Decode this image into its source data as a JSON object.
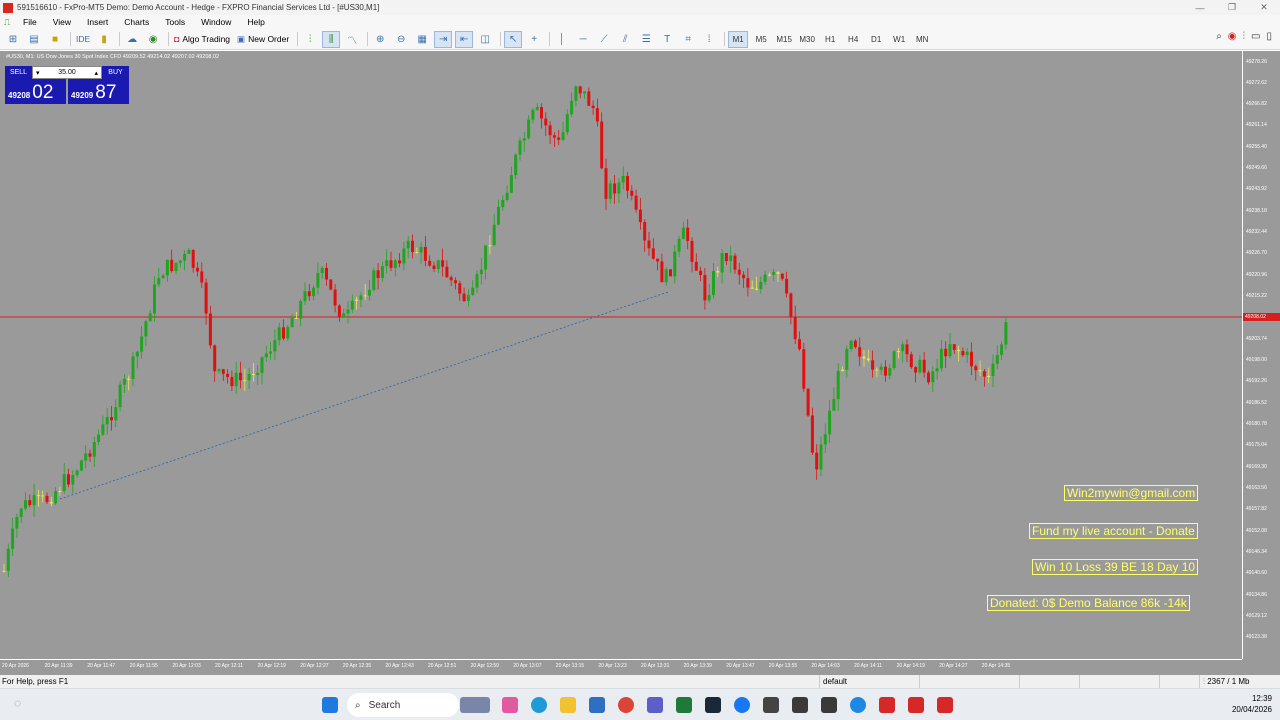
{
  "window": {
    "title": "591516610 - FxPro-MT5 Demo: Demo Account - Hedge - FXPRO Financial Services Ltd - [#US30,M1]",
    "controls": [
      "—",
      "❐",
      "✕"
    ]
  },
  "menu": [
    "File",
    "View",
    "Insert",
    "Charts",
    "Tools",
    "Window",
    "Help"
  ],
  "toolbar": {
    "algo_trading": "Algo Trading",
    "new_order": "New Order",
    "ide": "IDE",
    "timeframes": [
      "M1",
      "M5",
      "M15",
      "M30",
      "H1",
      "H4",
      "D1",
      "W1",
      "MN"
    ],
    "active_timeframe": "M1"
  },
  "chart": {
    "header": "#US30, M1:  US Dow Jones 30 Spot Index CFD   49209.52 49214.02 49207.02 49208.02",
    "trade_panel": {
      "sell_label": "SELL",
      "buy_label": "BUY",
      "lot": "35.00",
      "bid_prefix": "49208",
      "bid_big": "02",
      "ask_prefix": "49209",
      "ask_big": "87"
    },
    "current_price": "49208.02",
    "price_labels": [
      "49278.26",
      "49272.62",
      "49266.82",
      "49261.14",
      "49255.40",
      "49249.66",
      "49243.92",
      "49238.18",
      "49232.44",
      "49226.70",
      "49220.96",
      "49215.22",
      "49203.74",
      "49198.00",
      "49192.26",
      "49186.52",
      "49180.78",
      "49175.04",
      "49169.30",
      "49163.56",
      "49157.82",
      "49152.08",
      "49146.34",
      "49140.60",
      "49134.86",
      "49129.12",
      "49123.38"
    ],
    "time_labels": [
      "20 Apr 2026",
      "20 Apr 11:39",
      "20 Apr 11:47",
      "20 Apr 11:55",
      "20 Apr 12:03",
      "20 Apr 12:11",
      "20 Apr 12:19",
      "20 Apr 12:27",
      "20 Apr 12:35",
      "20 Apr 12:43",
      "20 Apr 12:51",
      "20 Apr 12:59",
      "20 Apr 13:07",
      "20 Apr 13:15",
      "20 Apr 13:23",
      "20 Apr 13:31",
      "20 Apr 13:39",
      "20 Apr 13:47",
      "20 Apr 13:55",
      "20 Apr 14:03",
      "20 Apr 14:11",
      "20 Apr 14:19",
      "20 Apr 14:27",
      "20 Apr 14:35"
    ],
    "notes": [
      "Win2mywin@gmail.com",
      "Fund my live account - Donate",
      "Win 10  Loss 39  BE 18  Day 10",
      "Donated: 0$  Demo Balance 86k -14k"
    ],
    "colors": {
      "background": "#9a9a9a",
      "bull": "#1fa51f",
      "bear": "#e01010",
      "doji": "#e8e850",
      "price_line": "#d62020"
    }
  },
  "status": {
    "help": "For Help, press F1",
    "profile": "default",
    "connection": "2367 / 1 Mb"
  },
  "taskbar": {
    "search_placeholder": "Search",
    "time": "12:39",
    "date": "20/04/2026"
  }
}
